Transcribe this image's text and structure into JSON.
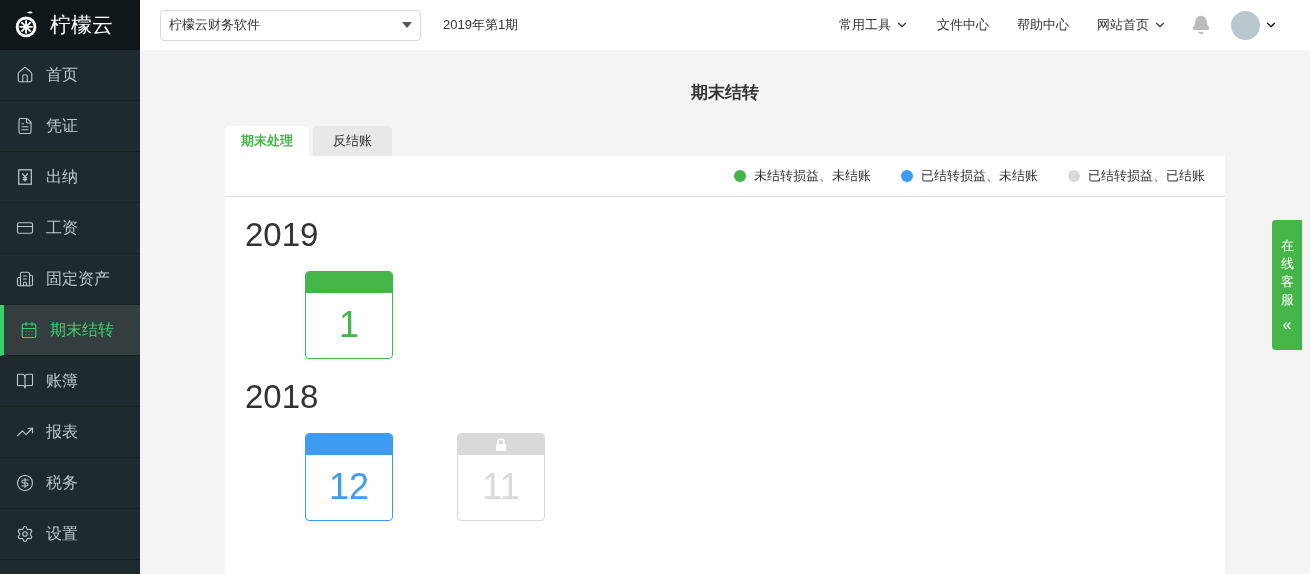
{
  "brand": {
    "name": "柠檬云"
  },
  "sidebar": {
    "items": [
      {
        "label": "首页",
        "selected": false
      },
      {
        "label": "凭证",
        "selected": false
      },
      {
        "label": "出纳",
        "selected": false
      },
      {
        "label": "工资",
        "selected": false
      },
      {
        "label": "固定资产",
        "selected": false
      },
      {
        "label": "期末结转",
        "selected": true
      },
      {
        "label": "账簿",
        "selected": false
      },
      {
        "label": "报表",
        "selected": false
      },
      {
        "label": "税务",
        "selected": false
      },
      {
        "label": "设置",
        "selected": false
      }
    ]
  },
  "topbar": {
    "account_select": {
      "value": "柠檬云财务软件"
    },
    "period": "2019年第1期",
    "nav": [
      {
        "label": "常用工具",
        "dropdown": true
      },
      {
        "label": "文件中心",
        "dropdown": false
      },
      {
        "label": "帮助中心",
        "dropdown": false
      },
      {
        "label": "网站首页",
        "dropdown": true
      }
    ]
  },
  "page": {
    "title": "期末结转",
    "tabs": [
      {
        "label": "期末处理",
        "selected": true
      },
      {
        "label": "反结账",
        "selected": false
      }
    ],
    "legend": [
      {
        "label": "未结转损益、未结账",
        "color": "#45b549"
      },
      {
        "label": "已结转损益、未结账",
        "color": "#3d9cf2"
      },
      {
        "label": "已结转损益、已结账",
        "color": "#d9d9d9"
      }
    ],
    "years": [
      {
        "year": "2019",
        "months": [
          {
            "month": "1",
            "color": "#45b549",
            "locked": false
          }
        ]
      },
      {
        "year": "2018",
        "months": [
          {
            "month": "12",
            "color": "#3d9cf2",
            "locked": false
          },
          {
            "month": "11",
            "color": "#d9d9d9",
            "locked": true
          }
        ]
      }
    ]
  },
  "service_tab": {
    "label": "在线客服",
    "arrow": "«"
  }
}
